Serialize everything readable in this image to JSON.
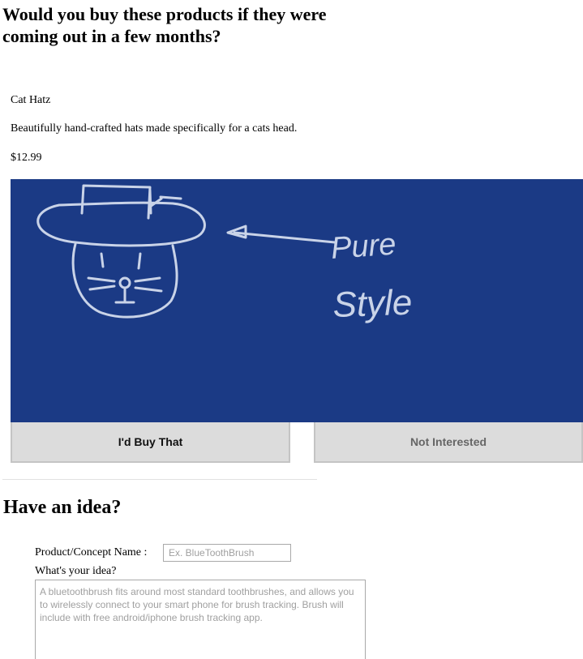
{
  "survey": {
    "heading": "Would you buy these products if they were coming out in a few months?"
  },
  "product": {
    "name": "Cat Hatz",
    "description": "Beautifully hand-crafted hats made specifically for a cats head.",
    "price": "$12.99",
    "image_text": [
      "Pure",
      "Style"
    ],
    "image_background": "#1b3a85",
    "image_ink": "#c9d3e8"
  },
  "buttons": {
    "buy_label": "I'd Buy That",
    "not_interested_label": "Not Interested"
  },
  "idea_section": {
    "heading": "Have an idea?",
    "name_label": "Product/Concept Name :",
    "name_placeholder": "Ex. BlueToothBrush",
    "idea_label": "What's your idea?",
    "idea_placeholder": "A bluetoothbrush fits around most standard toothbrushes, and allows you to wirelessly connect to your smart phone for brush tracking. Brush will include with free android/iphone brush tracking app."
  }
}
